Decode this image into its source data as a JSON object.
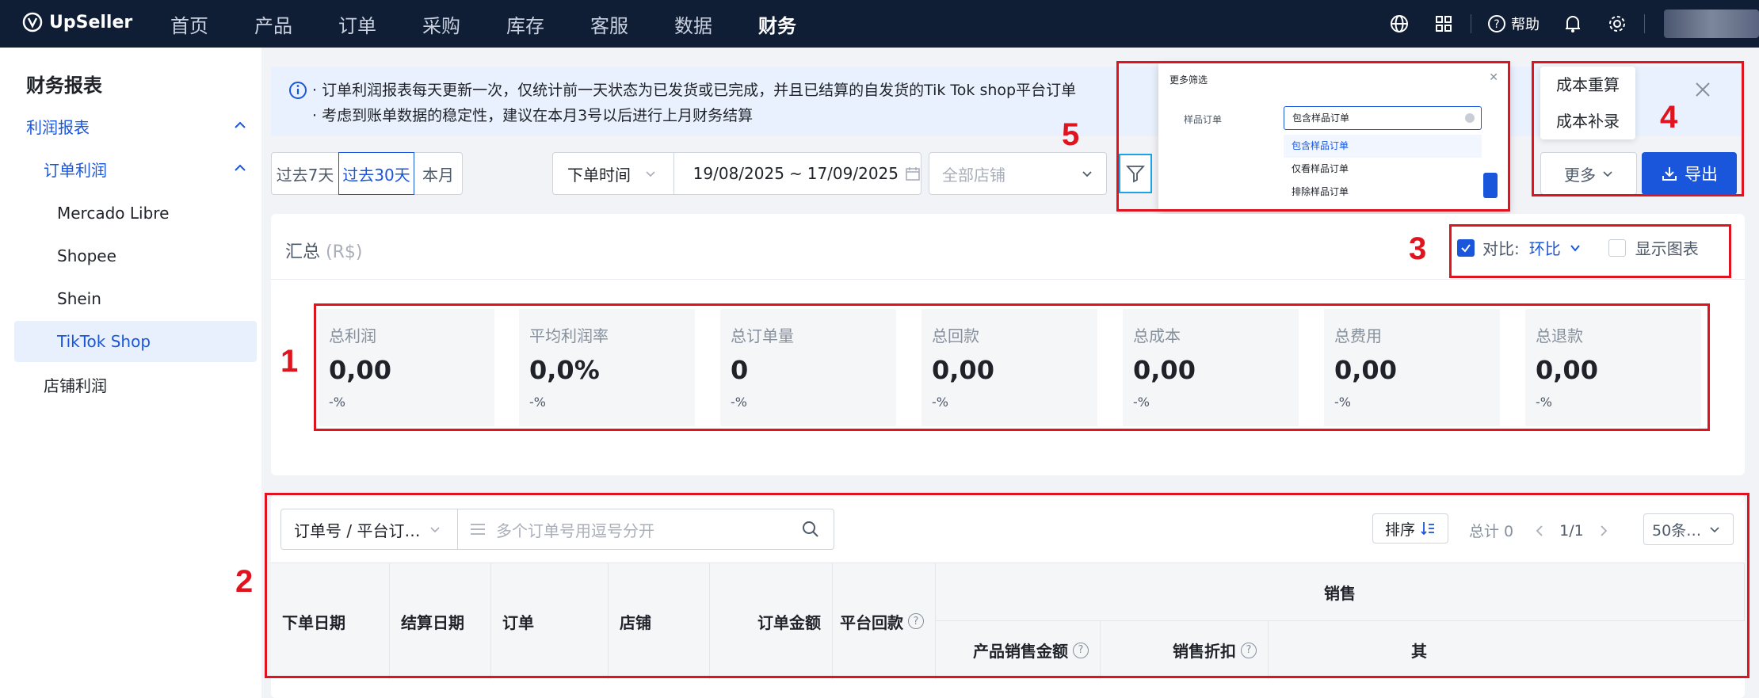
{
  "topbar": {
    "logo": "UpSeller",
    "nav": [
      "首页",
      "产品",
      "订单",
      "采购",
      "库存",
      "客服",
      "数据",
      "财务"
    ],
    "active_nav": "财务",
    "help": "帮助"
  },
  "sidebar": {
    "title": "财务报表",
    "items": [
      {
        "label": "利润报表"
      },
      {
        "label": "订单利润"
      },
      {
        "label": "Mercado Libre"
      },
      {
        "label": "Shopee"
      },
      {
        "label": "Shein"
      },
      {
        "label": "TikTok Shop"
      },
      {
        "label": "店铺利润"
      }
    ]
  },
  "notice": {
    "line1": "· 订单利润报表每天更新一次，仅统计前一天状态为已发货或已完成，并且已结算的自发货的Tik Tok shop平台订单",
    "line2": "· 考虑到账单数据的稳定性，建议在本月3号以后进行上月财务结算"
  },
  "filters": {
    "range_7": "过去7天",
    "range_30": "过去30天",
    "range_month": "本月",
    "time_type": "下单时间",
    "date_start": "19/08/2025",
    "date_sep": "~",
    "date_end": "17/09/2025",
    "shop_placeholder": "全部店铺"
  },
  "more_filter_popup": {
    "title": "更多筛选",
    "label": "样品订单",
    "selected": "包含样品订单",
    "options": [
      "包含样品订单",
      "仅看样品订单",
      "排除样品订单"
    ]
  },
  "more_menu": {
    "items": [
      "成本重算",
      "成本补录"
    ],
    "more_label": "更多",
    "export_label": "导出"
  },
  "summary": {
    "title": "汇总",
    "currency": "(R$)",
    "compare_label": "对比:",
    "compare_value": "环比",
    "show_chart": "显示图表",
    "metrics": [
      {
        "label": "总利润",
        "value": "0,00",
        "change": "-%"
      },
      {
        "label": "平均利润率",
        "value": "0,0%",
        "change": "-%"
      },
      {
        "label": "总订单量",
        "value": "0",
        "change": "-%"
      },
      {
        "label": "总回款",
        "value": "0,00",
        "change": "-%"
      },
      {
        "label": "总成本",
        "value": "0,00",
        "change": "-%"
      },
      {
        "label": "总费用",
        "value": "0,00",
        "change": "-%"
      },
      {
        "label": "总退款",
        "value": "0,00",
        "change": "-%"
      }
    ]
  },
  "table": {
    "search_type": "订单号 / 平台订…",
    "search_placeholder": "多个订单号用逗号分开",
    "sort_label": "排序",
    "total": "总计 0",
    "page": "1/1",
    "page_size": "50条…",
    "columns": [
      "下单日期",
      "结算日期",
      "订单",
      "店铺",
      "订单金额",
      "平台回款"
    ],
    "group_header": "销售",
    "sub_columns": [
      "产品销售金额",
      "销售折扣",
      "其"
    ]
  },
  "annotations": [
    "1",
    "2",
    "3",
    "4",
    "5"
  ],
  "colors": {
    "primary": "#1a56db",
    "annotation_red": "#e0141e",
    "topbar": "#0f1d35"
  }
}
